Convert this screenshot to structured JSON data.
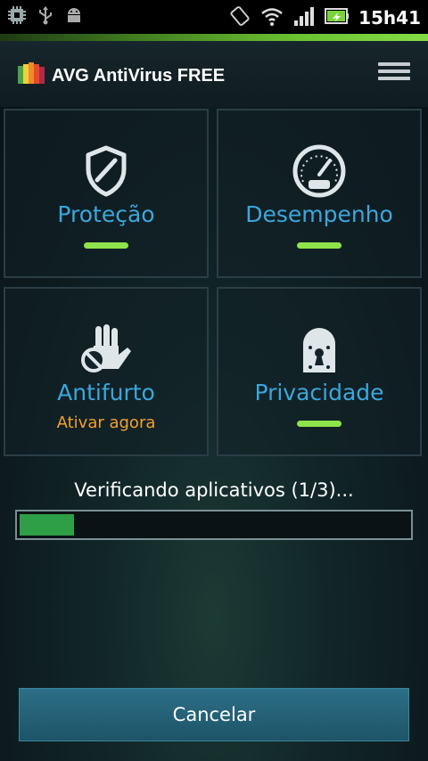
{
  "status_bar": {
    "time": "15h41",
    "icons_left": [
      "chip-icon",
      "usb-icon",
      "android-icon"
    ],
    "icons_right": [
      "rotate-icon",
      "wifi-icon",
      "signal-icon",
      "battery-icon"
    ]
  },
  "app": {
    "brand": "AVG",
    "product": "AntiVirus FREE",
    "accent_color": "#86dc45"
  },
  "tiles": [
    {
      "label": "Proteção",
      "icon": "shield-icon",
      "status": "ok"
    },
    {
      "label": "Desempenho",
      "icon": "speedometer-icon",
      "status": "ok"
    },
    {
      "label": "Antifurto",
      "icon": "stop-hand-icon",
      "sub": "Ativar agora"
    },
    {
      "label": "Privacidade",
      "icon": "lock-icon",
      "status": "ok"
    }
  ],
  "scan": {
    "text": "Verificando aplicativos (1/3)...",
    "progress_fraction": 0.14
  },
  "buttons": {
    "cancel": "Cancelar"
  }
}
